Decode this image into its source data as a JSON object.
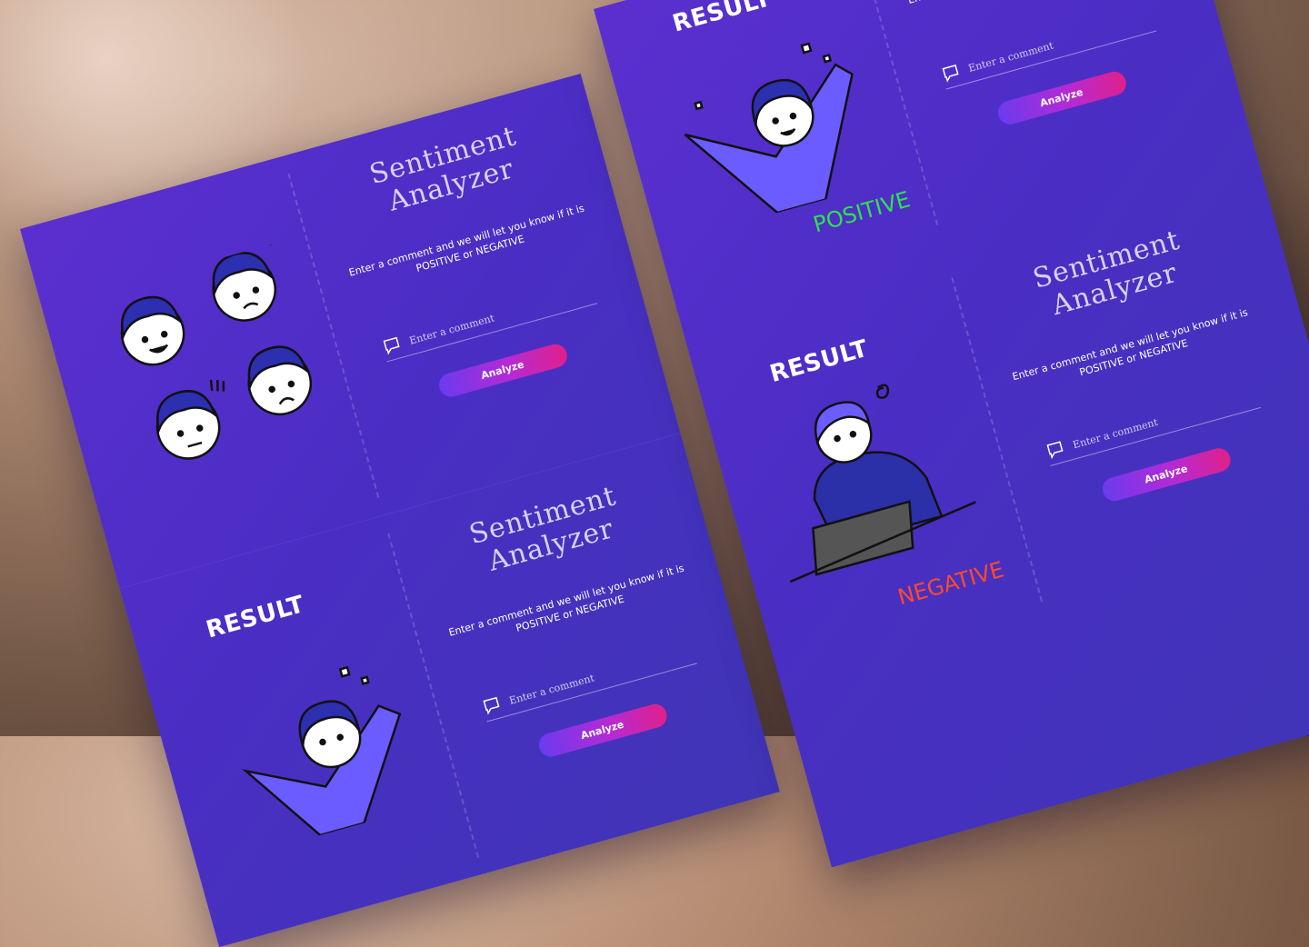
{
  "app": {
    "title": "Sentiment Analyzer",
    "description": "Enter a comment and we will let you know if it is POSITIVE or NEGATIVE",
    "input_placeholder": "Enter a comment",
    "button_label": "Analyze"
  },
  "result_heading": "RESULT",
  "outcomes": {
    "positive": "POSITIVE",
    "negative": "NEGATIVE"
  },
  "colors": {
    "panel": "#4a2ec4",
    "positive": "#2ee24c",
    "negative": "#ff4a2a",
    "button_start": "#6a3bf0",
    "button_end": "#e0208a"
  },
  "icons": [
    "comment-icon",
    "faces-illustration",
    "celebrating-person",
    "confused-person-laptop"
  ]
}
